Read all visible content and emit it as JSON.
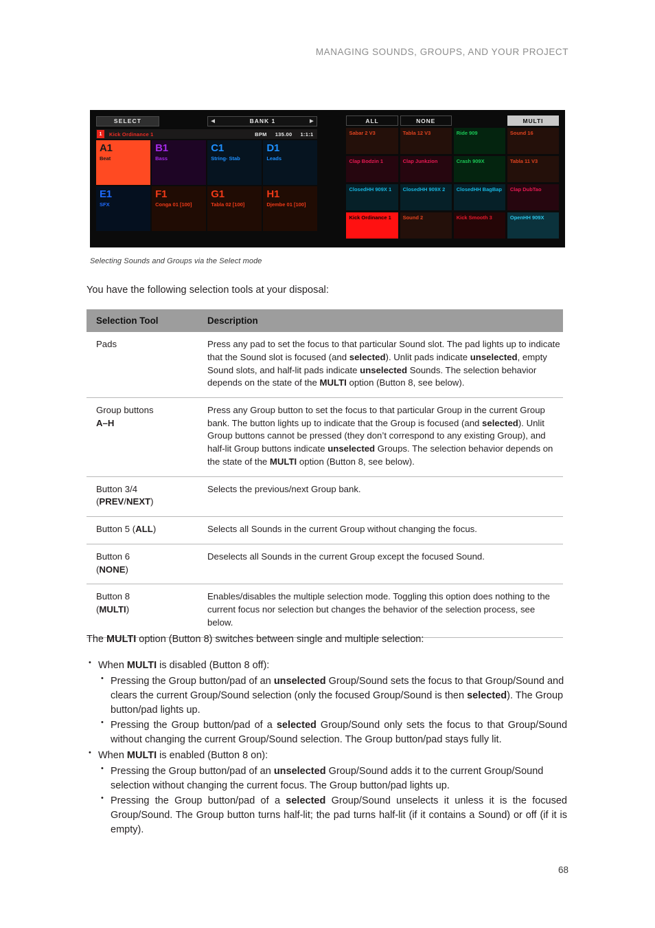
{
  "header": {
    "running_title": "MANAGING SOUNDS, GROUPS, AND YOUR PROJECT"
  },
  "page_number": "68",
  "figure": {
    "caption": "Selecting Sounds and Groups via the Select mode",
    "left_panel": {
      "select_button": "SELECT",
      "bank_prev_icon": "triangle-left-icon",
      "bank_label": "BANK 1",
      "bank_next_icon": "triangle-right-icon",
      "info": {
        "slot_number": "1",
        "sound_name": "Kick Ordinance 1",
        "bpm_label": "BPM",
        "bpm_value": "135.00",
        "position": "1:1:1"
      },
      "group_pads": [
        {
          "letter": "A1",
          "name": "Beat",
          "bg": "#ff4a22",
          "letter_color": "#1a1a1a",
          "name_color": "#1a1a1a"
        },
        {
          "letter": "B1",
          "name": "Bass",
          "bg": "#1e0525",
          "letter_color": "#a42ae8",
          "name_color": "#a42ae8"
        },
        {
          "letter": "C1",
          "name": "String- Stab",
          "bg": "#061420",
          "letter_color": "#1e90ff",
          "name_color": "#1e90ff"
        },
        {
          "letter": "D1",
          "name": "Leads",
          "bg": "#061420",
          "letter_color": "#1e90ff",
          "name_color": "#1e90ff"
        },
        {
          "letter": "E1",
          "name": "SFX",
          "bg": "#05101f",
          "letter_color": "#1e6bff",
          "name_color": "#1e6bff"
        },
        {
          "letter": "F1",
          "name": "Conga 01 [100]",
          "bg": "#200c04",
          "letter_color": "#ef3a18",
          "name_color": "#ef3a18"
        },
        {
          "letter": "G1",
          "name": "Tabla 02 [100]",
          "bg": "#200c04",
          "letter_color": "#ef3a18",
          "name_color": "#ef3a18"
        },
        {
          "letter": "H1",
          "name": "Djembe 01 [100]",
          "bg": "#200c04",
          "letter_color": "#ef3a18",
          "name_color": "#ef3a18"
        }
      ]
    },
    "right_panel": {
      "buttons": [
        {
          "label": "ALL",
          "state": "normal"
        },
        {
          "label": "NONE",
          "state": "normal"
        },
        {
          "label": "",
          "state": "blank"
        },
        {
          "label": "MULTI",
          "state": "active"
        }
      ],
      "sound_pads": [
        {
          "name": "Sabar 2 V3",
          "bg": "#24100a",
          "text": "#e0431f"
        },
        {
          "name": "Tabla 12 V3",
          "bg": "#24100a",
          "text": "#e0431f"
        },
        {
          "name": "Ride 909",
          "bg": "#04240f",
          "text": "#1bc756"
        },
        {
          "name": "Sound 16",
          "bg": "#24100a",
          "text": "#e0431f"
        },
        {
          "name": "Clap Bodzin 1",
          "bg": "#26060f",
          "text": "#e61a52"
        },
        {
          "name": "Clap Junkzion",
          "bg": "#26060f",
          "text": "#e61a52"
        },
        {
          "name": "Crash 909X",
          "bg": "#04240f",
          "text": "#1bc756"
        },
        {
          "name": "Tabla 11 V3",
          "bg": "#24100a",
          "text": "#e0431f"
        },
        {
          "name": "ClosedHH 909X 1",
          "bg": "#062028",
          "text": "#18b6e0"
        },
        {
          "name": "ClosedHH 909X 2",
          "bg": "#062028",
          "text": "#18b6e0"
        },
        {
          "name": "ClosedHH BagBap",
          "bg": "#062028",
          "text": "#18b6e0"
        },
        {
          "name": "Clap DubTao",
          "bg": "#26060f",
          "text": "#e61a52"
        },
        {
          "name": "Kick Ordinance 1",
          "bg": "#ff1111",
          "text": "#140000"
        },
        {
          "name": "Sound 2",
          "bg": "#24100a",
          "text": "#e0431f"
        },
        {
          "name": "Kick Smooth 3",
          "bg": "#250607",
          "text": "#e6192c"
        },
        {
          "name": "OpenHH 909X",
          "bg": "#0b323c",
          "text": "#2bc5e8"
        }
      ]
    }
  },
  "intro_text": "You have the following selection tools at your disposal:",
  "table": {
    "columns": [
      "Selection Tool",
      "Description"
    ],
    "rows": [
      {
        "tool_line1": "Pads",
        "tool_line2": "",
        "desc": "Press any pad to set the focus to that particular Sound slot. The pad lights up to indicate that the Sound slot is focused (and selected). Unlit pads indicate unselected, empty Sound slots, and half-lit pads indicate unselected Sounds. The selection behavior depends on the state of the MULTI option (Button 8, see below)."
      },
      {
        "tool_line1": "Group buttons",
        "tool_line2": "A–H",
        "desc": "Press any Group button to set the focus to that particular Group in the current Group bank. The button lights up to indicate that the Group is focused (and selected). Unlit Group buttons cannot be pressed (they don’t correspond to any existing Group), and half-lit Group buttons indicate unselected Groups. The selection behavior depends on the state of the MULTI option (Button 8, see below)."
      },
      {
        "tool_line1": "Button 3/4",
        "tool_line2": "(PREV/NEXT)",
        "desc": "Selects the previous/next Group bank."
      },
      {
        "tool_line1": "Button 5 (ALL)",
        "tool_line2": "",
        "desc": "Selects all Sounds in the current Group without changing the focus."
      },
      {
        "tool_line1": "Button 6",
        "tool_line2": "(NONE)",
        "desc": "Deselects all Sounds in the current Group except the focused Sound."
      },
      {
        "tool_line1": "Button 8",
        "tool_line2": "(MULTI)",
        "desc": "Enables/disables the multiple selection mode. Toggling this option does nothing to the current focus nor selection but changes the behavior of the selection process, see below."
      }
    ]
  },
  "multi_paragraph": "The MULTI option (Button 8) switches between single and multiple selection:",
  "bullets": [
    {
      "text": "When MULTI is disabled (Button 8 off):",
      "children": [
        "Pressing the Group button/pad of an unselected Group/Sound sets the focus to that Group/Sound and clears the current Group/Sound selection (only the focused Group/Sound is then selected). The Group button/pad lights up.",
        "Pressing the Group button/pad of a selected Group/Sound only sets the focus to that Group/Sound without changing the current Group/Sound selection. The Group button/pad stays fully lit."
      ]
    },
    {
      "text": "When MULTI is enabled (Button 8 on):",
      "children": [
        "Pressing the Group button/pad of an unselected Group/Sound adds it to the current Group/Sound selection without changing the current focus. The Group button/pad lights up.",
        "Pressing the Group button/pad of a selected Group/Sound unselects it unless it is the focused Group/Sound. The Group button turns half-lit; the pad turns half-lit (if it contains a Sound) or off (if it is empty)."
      ]
    }
  ]
}
